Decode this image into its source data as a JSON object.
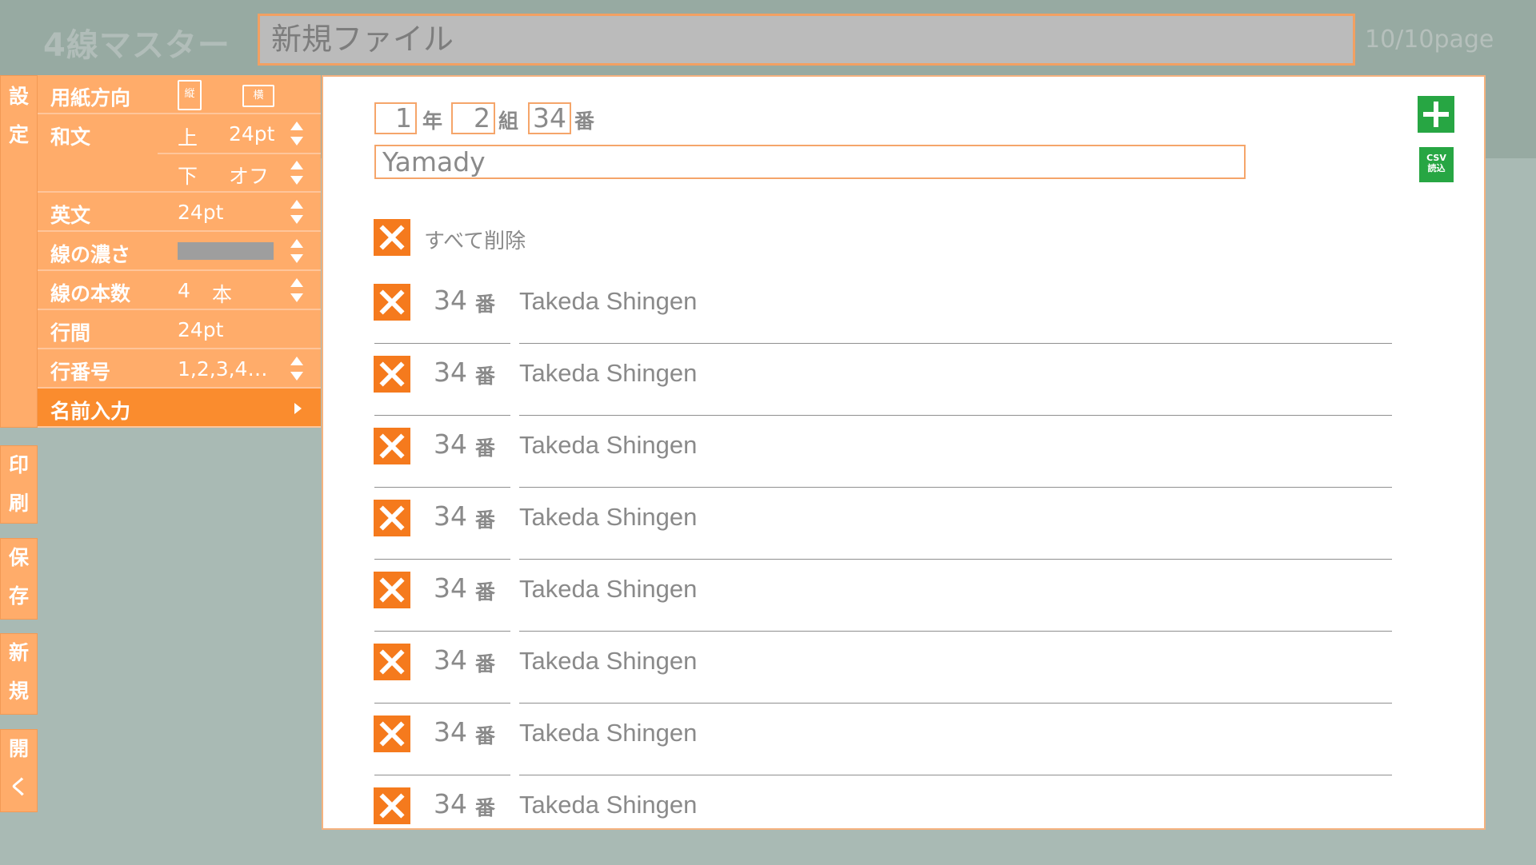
{
  "header": {
    "app_title": "4線マスター",
    "filename": "新規ファイル",
    "page_count": "10/10page"
  },
  "side_tabs": {
    "settings": [
      "設",
      "定"
    ],
    "print": [
      "印",
      "刷"
    ],
    "save": [
      "保",
      "存"
    ],
    "new": [
      "新",
      "規"
    ],
    "open": [
      "開",
      "く"
    ]
  },
  "settings": {
    "orientation": {
      "label": "用紙方向",
      "portrait": "縦",
      "landscape": "横"
    },
    "japanese": {
      "label": "和文",
      "upper_label": "上",
      "upper_value": "24pt",
      "lower_label": "下",
      "lower_value": "オフ"
    },
    "english": {
      "label": "英文",
      "value": "24pt"
    },
    "density": {
      "label": "線の濃さ"
    },
    "line_count": {
      "label": "線の本数",
      "value": "4",
      "unit": "本"
    },
    "line_spacing": {
      "label": "行間",
      "value": "24pt"
    },
    "line_number": {
      "label": "行番号",
      "value": "1,2,3,4…"
    },
    "name_input": {
      "label": "名前入力"
    }
  },
  "form": {
    "year": "1",
    "year_label": "年",
    "class": "2",
    "class_label": "組",
    "number": "34",
    "number_label": "番",
    "name": "Yamady",
    "csv_label_1": "CSV",
    "csv_label_2": "読込",
    "delete_all_label": "すべて削除"
  },
  "entries": [
    {
      "number": "34",
      "suffix": "番",
      "name": "Takeda Shingen"
    },
    {
      "number": "34",
      "suffix": "番",
      "name": "Takeda Shingen"
    },
    {
      "number": "34",
      "suffix": "番",
      "name": "Takeda Shingen"
    },
    {
      "number": "34",
      "suffix": "番",
      "name": "Takeda Shingen"
    },
    {
      "number": "34",
      "suffix": "番",
      "name": "Takeda Shingen"
    },
    {
      "number": "34",
      "suffix": "番",
      "name": "Takeda Shingen"
    },
    {
      "number": "34",
      "suffix": "番",
      "name": "Takeda Shingen"
    },
    {
      "number": "34",
      "suffix": "番",
      "name": "Takeda Shingen"
    }
  ],
  "colors": {
    "accent": "#ffac6a",
    "accent_active": "#fa8c2e",
    "delete": "#f57a1d",
    "add": "#27a643",
    "background": "#a9bab4"
  }
}
